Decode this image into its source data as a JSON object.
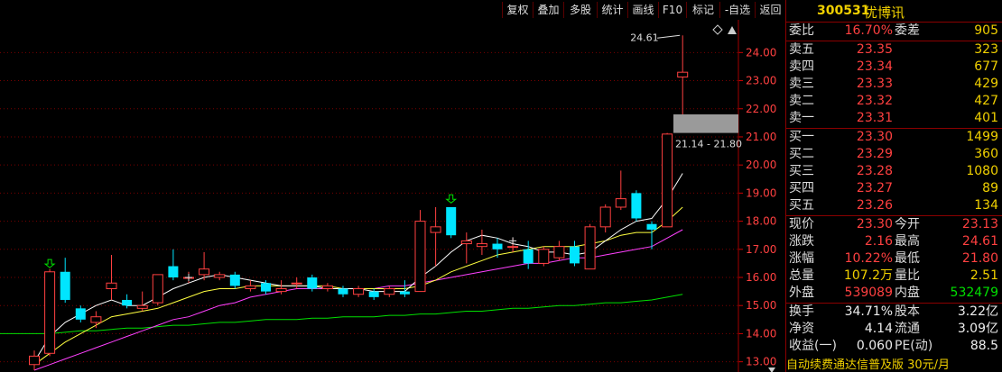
{
  "toolbar": {
    "buttons": [
      "复权",
      "叠加",
      "多股",
      "统计",
      "画线",
      "F10",
      "标记",
      "-自选",
      "返回"
    ]
  },
  "chart": {
    "hi_label": "24.61",
    "range_label": "21.14 - 21.80",
    "y_ticks": [
      "24.00",
      "23.00",
      "22.00",
      "21.00",
      "20.00",
      "19.00",
      "18.00",
      "17.00",
      "16.00",
      "15.00",
      "14.00",
      "13.00"
    ],
    "colors": {
      "up": "#ff4040",
      "down": "#00e5ff",
      "ma5": "#ffffff",
      "ma10": "#ffff40",
      "ma20": "#ff40ff",
      "ma60": "#00e000",
      "grid": "#7a0000"
    }
  },
  "chart_data": {
    "type": "candlestick",
    "ylim": [
      12.7,
      25.1
    ],
    "candles": [
      {
        "o": 12.9,
        "c": 13.2,
        "h": 13.4,
        "l": 12.7
      },
      {
        "o": 13.3,
        "c": 16.2,
        "h": 16.3,
        "l": 13.2
      },
      {
        "o": 16.2,
        "c": 15.2,
        "h": 16.7,
        "l": 15.1
      },
      {
        "o": 14.9,
        "c": 14.5,
        "h": 15.0,
        "l": 14.4
      },
      {
        "o": 14.4,
        "c": 14.6,
        "h": 14.8,
        "l": 14.2
      },
      {
        "o": 15.6,
        "c": 15.8,
        "h": 16.8,
        "l": 15.2
      },
      {
        "o": 15.2,
        "c": 15.0,
        "h": 15.4,
        "l": 14.9
      },
      {
        "o": 14.9,
        "c": 15.0,
        "h": 15.5,
        "l": 14.8
      },
      {
        "o": 15.1,
        "c": 16.1,
        "h": 16.1,
        "l": 15.0
      },
      {
        "o": 16.4,
        "c": 16.0,
        "h": 17.0,
        "l": 15.9
      },
      {
        "o": 16.0,
        "c": 16.0,
        "h": 16.2,
        "l": 15.8
      },
      {
        "o": 16.1,
        "c": 16.3,
        "h": 16.9,
        "l": 15.9
      },
      {
        "o": 16.0,
        "c": 16.1,
        "h": 16.2,
        "l": 15.9
      },
      {
        "o": 16.1,
        "c": 15.7,
        "h": 16.2,
        "l": 15.6
      },
      {
        "o": 15.6,
        "c": 15.7,
        "h": 15.9,
        "l": 15.5
      },
      {
        "o": 15.8,
        "c": 15.5,
        "h": 15.9,
        "l": 15.4
      },
      {
        "o": 15.5,
        "c": 15.6,
        "h": 15.9,
        "l": 15.4
      },
      {
        "o": 15.8,
        "c": 15.8,
        "h": 16.0,
        "l": 15.6
      },
      {
        "o": 16.0,
        "c": 15.6,
        "h": 16.1,
        "l": 15.5
      },
      {
        "o": 15.6,
        "c": 15.7,
        "h": 15.8,
        "l": 15.5
      },
      {
        "o": 15.6,
        "c": 15.4,
        "h": 15.7,
        "l": 15.3
      },
      {
        "o": 15.4,
        "c": 15.6,
        "h": 15.7,
        "l": 15.3
      },
      {
        "o": 15.5,
        "c": 15.3,
        "h": 15.6,
        "l": 15.2
      },
      {
        "o": 15.4,
        "c": 15.6,
        "h": 15.7,
        "l": 15.3
      },
      {
        "o": 15.5,
        "c": 15.4,
        "h": 15.9,
        "l": 15.3
      },
      {
        "o": 15.5,
        "c": 18.0,
        "h": 18.4,
        "l": 15.5
      },
      {
        "o": 17.6,
        "c": 17.8,
        "h": 18.5,
        "l": 16.4
      },
      {
        "o": 18.5,
        "c": 17.5,
        "h": 18.5,
        "l": 17.4
      },
      {
        "o": 17.2,
        "c": 17.3,
        "h": 17.6,
        "l": 16.5
      },
      {
        "o": 17.1,
        "c": 17.2,
        "h": 17.7,
        "l": 16.8
      },
      {
        "o": 17.2,
        "c": 17.0,
        "h": 17.4,
        "l": 16.7
      },
      {
        "o": 17.1,
        "c": 17.1,
        "h": 17.4,
        "l": 16.9
      },
      {
        "o": 17.0,
        "c": 16.5,
        "h": 17.3,
        "l": 16.3
      },
      {
        "o": 16.5,
        "c": 17.0,
        "h": 17.1,
        "l": 16.4
      },
      {
        "o": 16.7,
        "c": 17.1,
        "h": 17.3,
        "l": 16.6
      },
      {
        "o": 17.1,
        "c": 16.5,
        "h": 17.3,
        "l": 16.4
      },
      {
        "o": 16.3,
        "c": 17.8,
        "h": 17.9,
        "l": 16.3
      },
      {
        "o": 17.8,
        "c": 18.5,
        "h": 18.6,
        "l": 17.6
      },
      {
        "o": 18.5,
        "c": 18.8,
        "h": 19.8,
        "l": 18.4
      },
      {
        "o": 19.0,
        "c": 18.1,
        "h": 19.1,
        "l": 18.0
      },
      {
        "o": 17.9,
        "c": 17.7,
        "h": 18.0,
        "l": 17.0
      },
      {
        "o": 17.8,
        "c": 21.1,
        "h": 21.14,
        "l": 17.8
      },
      {
        "o": 23.13,
        "c": 23.3,
        "h": 24.61,
        "l": 21.8
      }
    ],
    "ma5": [
      13.0,
      13.9,
      14.4,
      14.7,
      15.0,
      15.2,
      15.0,
      15.0,
      15.3,
      15.6,
      15.8,
      16.0,
      16.1,
      16.0,
      15.9,
      15.8,
      15.7,
      15.7,
      15.7,
      15.6,
      15.6,
      15.6,
      15.5,
      15.5,
      15.5,
      16.0,
      16.4,
      16.9,
      17.3,
      17.5,
      17.4,
      17.2,
      17.1,
      16.9,
      16.9,
      16.8,
      16.9,
      17.3,
      17.7,
      18.0,
      18.1,
      18.8,
      19.7
    ],
    "ma10": [
      12.9,
      13.3,
      13.7,
      14.0,
      14.3,
      14.6,
      14.7,
      14.8,
      14.9,
      15.1,
      15.3,
      15.5,
      15.6,
      15.6,
      15.7,
      15.7,
      15.7,
      15.7,
      15.7,
      15.7,
      15.6,
      15.6,
      15.6,
      15.6,
      15.6,
      15.7,
      15.9,
      16.2,
      16.4,
      16.6,
      16.8,
      16.9,
      17.0,
      17.1,
      17.1,
      17.1,
      17.2,
      17.3,
      17.5,
      17.6,
      17.6,
      18.0,
      18.5
    ],
    "ma20": [
      12.7,
      12.9,
      13.1,
      13.3,
      13.5,
      13.7,
      13.9,
      14.1,
      14.3,
      14.5,
      14.6,
      14.8,
      15.0,
      15.1,
      15.3,
      15.4,
      15.5,
      15.6,
      15.6,
      15.6,
      15.6,
      15.6,
      15.6,
      15.7,
      15.7,
      15.8,
      15.9,
      16.0,
      16.1,
      16.2,
      16.3,
      16.4,
      16.5,
      16.5,
      16.6,
      16.7,
      16.7,
      16.8,
      16.9,
      17.0,
      17.1,
      17.4,
      17.7
    ],
    "ma60": [
      14.0,
      14.0,
      14.05,
      14.1,
      14.1,
      14.15,
      14.2,
      14.2,
      14.25,
      14.3,
      14.3,
      14.35,
      14.4,
      14.4,
      14.45,
      14.5,
      14.5,
      14.5,
      14.55,
      14.55,
      14.6,
      14.6,
      14.6,
      14.65,
      14.65,
      14.7,
      14.7,
      14.75,
      14.8,
      14.8,
      14.85,
      14.9,
      14.9,
      14.95,
      15.0,
      15.0,
      15.05,
      15.1,
      15.1,
      15.15,
      15.2,
      15.3,
      15.4
    ]
  },
  "quote": {
    "code": "300531",
    "name": "优博讯",
    "ratio": {
      "l1": "委比",
      "v1": "16.70%",
      "l2": "委差",
      "v2": "905"
    },
    "asks": [
      {
        "label": "卖五",
        "price": "23.35",
        "vol": "323"
      },
      {
        "label": "卖四",
        "price": "23.34",
        "vol": "677"
      },
      {
        "label": "卖三",
        "price": "23.33",
        "vol": "429"
      },
      {
        "label": "卖二",
        "price": "23.32",
        "vol": "427"
      },
      {
        "label": "卖一",
        "price": "23.31",
        "vol": "401"
      }
    ],
    "bids": [
      {
        "label": "买一",
        "price": "23.30",
        "vol": "1499"
      },
      {
        "label": "买二",
        "price": "23.29",
        "vol": "360"
      },
      {
        "label": "买三",
        "price": "23.28",
        "vol": "1080"
      },
      {
        "label": "买四",
        "price": "23.27",
        "vol": "89"
      },
      {
        "label": "买五",
        "price": "23.26",
        "vol": "134"
      }
    ],
    "stats1": [
      {
        "l1": "现价",
        "v1": "23.30",
        "l2": "今开",
        "v2": "23.13"
      },
      {
        "l1": "涨跌",
        "v1": "2.16",
        "l2": "最高",
        "v2": "24.61"
      },
      {
        "l1": "涨幅",
        "v1": "10.22%",
        "l2": "最低",
        "v2": "21.80"
      },
      {
        "l1": "总量",
        "v1": "107.2万",
        "l2": "量比",
        "v2": "2.51"
      },
      {
        "l1": "外盘",
        "v1": "539089",
        "l2": "内盘",
        "v2": "532479"
      }
    ],
    "stats2": [
      {
        "l1": "换手",
        "v1": "34.71%",
        "l2": "股本",
        "v2": "3.22亿"
      },
      {
        "l1": "净资",
        "v1": "4.14",
        "l2": "流通",
        "v2": "3.09亿"
      },
      {
        "l1": "收益(一)",
        "v1": "0.060",
        "l2": "PE(动)",
        "v2": "88.5"
      }
    ],
    "ad": "自动续费通达信普及版  30元/月"
  }
}
